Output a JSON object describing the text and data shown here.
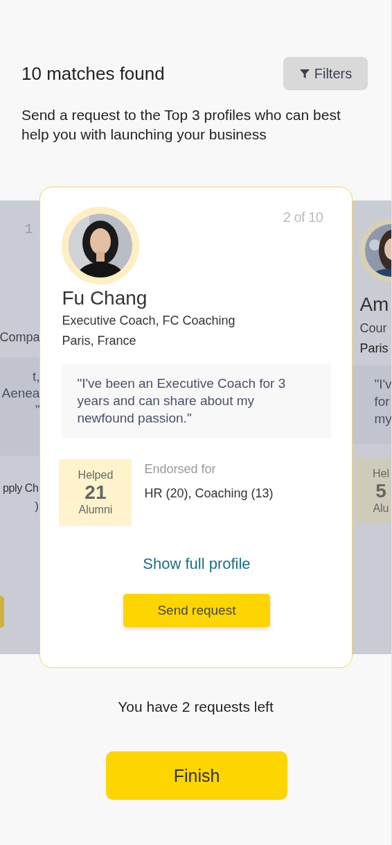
{
  "header": {
    "title": "10 matches found",
    "filter_button": "Filters"
  },
  "intro": "Send a request to the Top 3 profiles who can best help you with launching your business",
  "left_card": {
    "counter": "1",
    "subtitle": "Compa",
    "quote_lines": [
      "t,",
      "Aenea",
      "”"
    ],
    "endorsed_lines": [
      "pply Ch",
      ")"
    ]
  },
  "main_card": {
    "counter": "2 of 10",
    "name": "Fu Chang",
    "subtitle": "Executive Coach, FC Coaching",
    "location": "Paris, France",
    "quote": "\"I've been an Executive Coach for 3 years and can share about my newfound passion.\"",
    "helped_label": "Helped",
    "helped_count": "21",
    "alumni_label": "Alumni",
    "endorsed_label": "Endorsed for",
    "endorsed_value": "HR (20), Coaching (13)",
    "profile_link": "Show full profile",
    "request_button": "Send request"
  },
  "right_card": {
    "name": "Am",
    "subtitle": "Cour",
    "location": "Paris",
    "quote_lines": [
      "\"I'v",
      "for",
      "my"
    ],
    "helped_label": "Hel",
    "helped_count": "5",
    "alumni_label": "Alu"
  },
  "requests_left": "You have 2 requests left",
  "finish_button": "Finish"
}
